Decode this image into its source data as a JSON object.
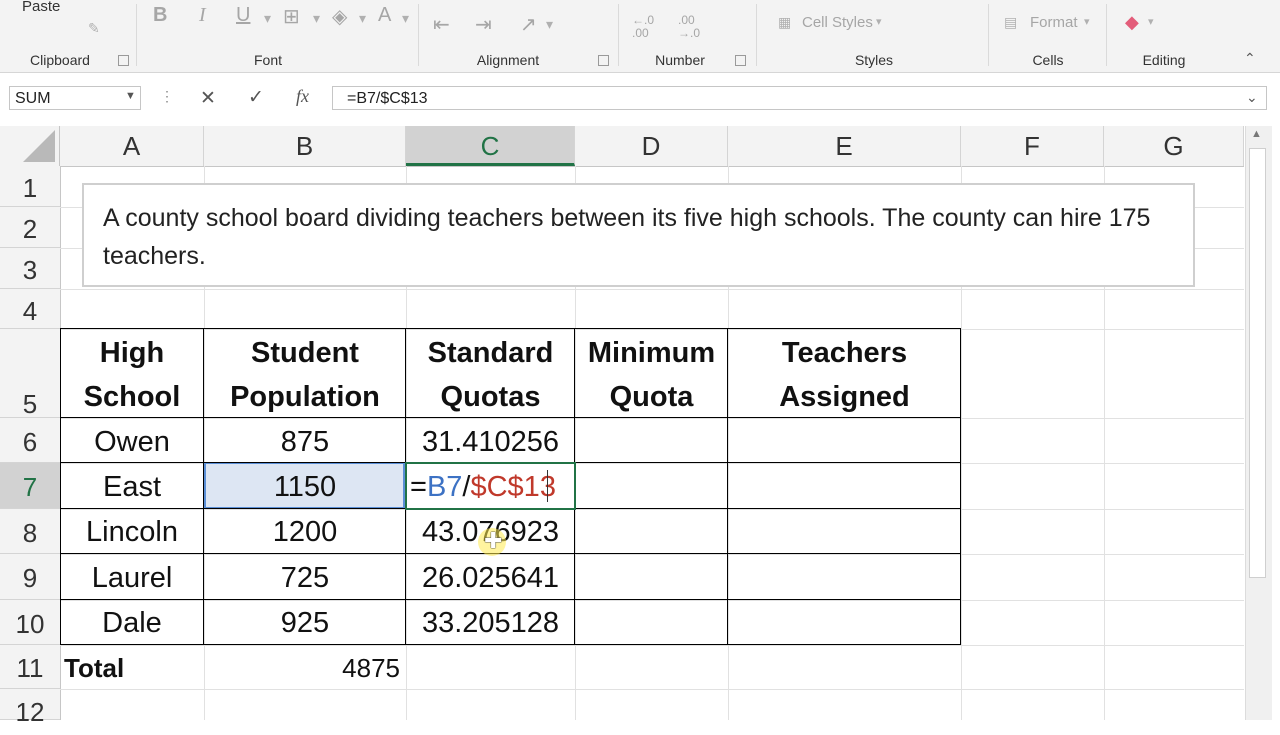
{
  "ribbon": {
    "paste_label": "Paste",
    "groups": [
      "Clipboard",
      "Font",
      "Alignment",
      "Number",
      "Styles",
      "Cells",
      "Editing"
    ],
    "cell_styles_label": "Cell Styles",
    "format_label": "Format",
    "bold": "B",
    "italic": "I",
    "underline": "U",
    "font_color": "A",
    "num_inc": "←.0\n.00",
    "num_dec": ".00\n→.0"
  },
  "formula_bar": {
    "name_box": "SUM",
    "cancel": "✕",
    "enter": "✓",
    "fx": "fx",
    "formula": "=B7/$C$13"
  },
  "columns": [
    "A",
    "B",
    "C",
    "D",
    "E",
    "F",
    "G"
  ],
  "rows": [
    "1",
    "2",
    "3",
    "4",
    "5",
    "6",
    "7",
    "8",
    "9",
    "10",
    "11",
    "12"
  ],
  "textbox": "A county school board dividing teachers between its five high schools.  The county can hire 175 teachers.",
  "table": {
    "headers": [
      [
        "High",
        "School"
      ],
      [
        "Student",
        "Population"
      ],
      [
        "Standard",
        "Quotas"
      ],
      [
        "Minimum",
        "Quota"
      ],
      [
        "Teachers",
        "Assigned"
      ]
    ],
    "rows": [
      {
        "school": "Owen",
        "population": "875",
        "quota": "31.410256"
      },
      {
        "school": "East",
        "population": "1150",
        "quota": ""
      },
      {
        "school": "Lincoln",
        "population": "1200",
        "quota": "43.076923"
      },
      {
        "school": "Laurel",
        "population": "725",
        "quota": "26.025641"
      },
      {
        "school": "Dale",
        "population": "925",
        "quota": "33.205128"
      }
    ],
    "total_label": "Total",
    "total_value": "4875"
  },
  "editing_cell": {
    "eq": "=",
    "ref1": "B7",
    "slash": "/",
    "ref2": "$C$13"
  },
  "colors": {
    "excel_green": "#217346",
    "ref_blue": "#3d72c4",
    "ref_red": "#c0392b"
  }
}
